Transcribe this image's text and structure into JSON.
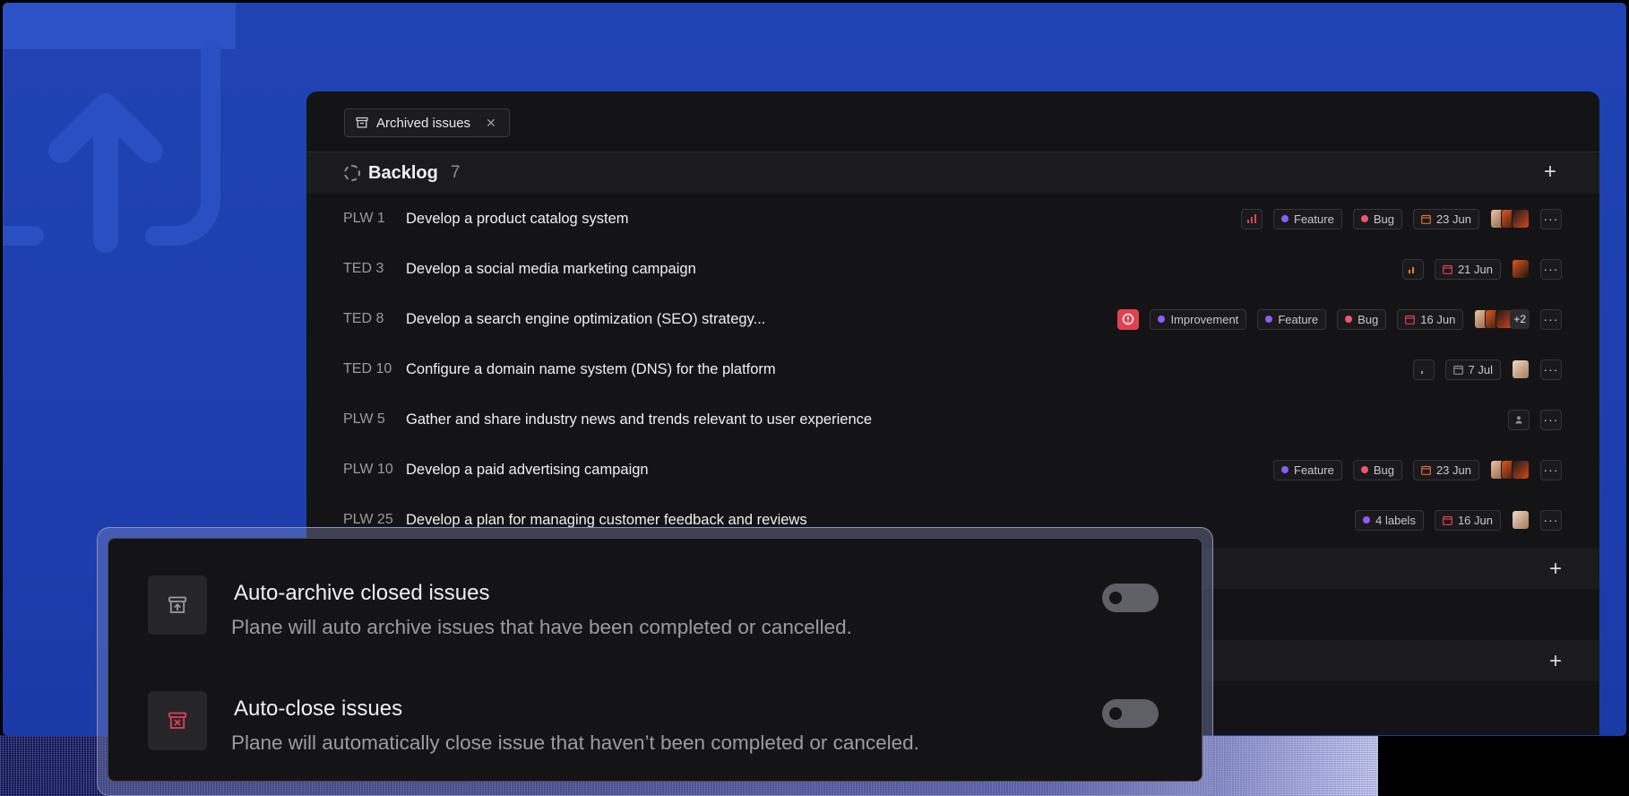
{
  "filter_chip": {
    "label": "Archived issues",
    "icon": "archive-icon"
  },
  "group": {
    "title": "Backlog",
    "count": "7"
  },
  "issues": [
    {
      "id": "PLW 1",
      "title": "Develop a product catalog system",
      "labels": [
        {
          "name": "Feature",
          "color": "#8b5cf6"
        },
        {
          "name": "Bug",
          "color": "#f0566e"
        }
      ],
      "date": "23 Jun"
    },
    {
      "id": "TED 3",
      "title": "Develop a social media marketing campaign",
      "labels": [],
      "date": "21 Jun"
    },
    {
      "id": "TED 8",
      "title": "Develop a search engine optimization (SEO) strategy...",
      "labels": [
        {
          "name": "Improvement",
          "color": "#8b5cf6"
        },
        {
          "name": "Feature",
          "color": "#8b5cf6"
        },
        {
          "name": "Bug",
          "color": "#f0566e"
        }
      ],
      "date": "16 Jun",
      "extra_assignees": "+2"
    },
    {
      "id": "TED 10",
      "title": "Configure a domain name system (DNS) for the platform",
      "labels": [],
      "date": "7 Jul"
    },
    {
      "id": "PLW 5",
      "title": "Gather and share industry news and trends relevant to user experience",
      "labels": [],
      "date": ""
    },
    {
      "id": "PLW 10",
      "title": "Develop a paid advertising campaign",
      "labels": [
        {
          "name": "Feature",
          "color": "#8b5cf6"
        },
        {
          "name": "Bug",
          "color": "#f0566e"
        }
      ],
      "date": "23 Jun"
    },
    {
      "id": "PLW 25",
      "title": "Develop a plan for managing customer feedback and reviews",
      "labels": [
        {
          "name": "4 labels",
          "color": "#8b5cf6"
        }
      ],
      "date": "16 Jun"
    }
  ],
  "settings": [
    {
      "title": "Auto-archive closed issues",
      "description": "Plane will auto archive issues that have been completed or cancelled.",
      "icon": "archive-box-icon",
      "enabled": false
    },
    {
      "title": "Auto-close issues",
      "description": "Plane will automatically close issue that haven’t been completed or canceled.",
      "icon": "archive-close-icon",
      "enabled": false
    }
  ],
  "colors": {
    "accent_blue": "#1d3fae",
    "urgent": "#e0424f",
    "feature_dot": "#8b5cf6",
    "bug_dot": "#f0566e",
    "date_due": "#e06c3a"
  }
}
